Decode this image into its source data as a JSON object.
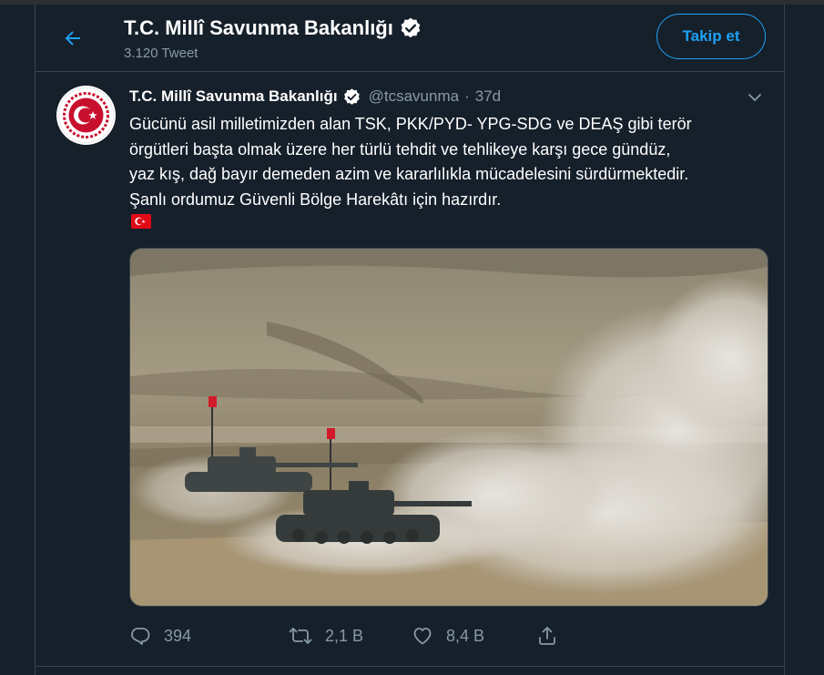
{
  "header": {
    "title": "T.C. Millî Savunma Bakanlığı",
    "tweet_count": "3.120 Tweet",
    "follow_label": "Takip et"
  },
  "tweet": {
    "author_name": "T.C. Millî Savunma Bakanlığı",
    "handle": "@tcsavunma",
    "separator": "·",
    "time": "37d",
    "text_lines": [
      "Gücünü asil milletimizden alan TSK, PKK/PYD- YPG-SDG ve DEAŞ gibi terör",
      "örgütleri başta olmak üzere her türlü tehdit ve tehlikeye karşı gece gündüz,",
      "yaz kış, dağ bayır demeden azim ve kararlılıkla mücadelesini sürdürmektedir.",
      "Şanlı ordumuz Güvenli Bölge Harekâtı için hazırdır."
    ],
    "actions": {
      "reply_count": "394",
      "retweet_count": "2,1 B",
      "like_count": "8,4 B"
    }
  },
  "colors": {
    "background": "#15202b",
    "accent": "#1da1f2",
    "muted_text": "#8899a6",
    "border": "#38444d"
  },
  "icons": [
    "back-arrow-icon",
    "verified-badge-icon",
    "chevron-down-icon",
    "reply-icon",
    "retweet-icon",
    "like-icon",
    "share-icon",
    "turkish-flag-emoji"
  ]
}
